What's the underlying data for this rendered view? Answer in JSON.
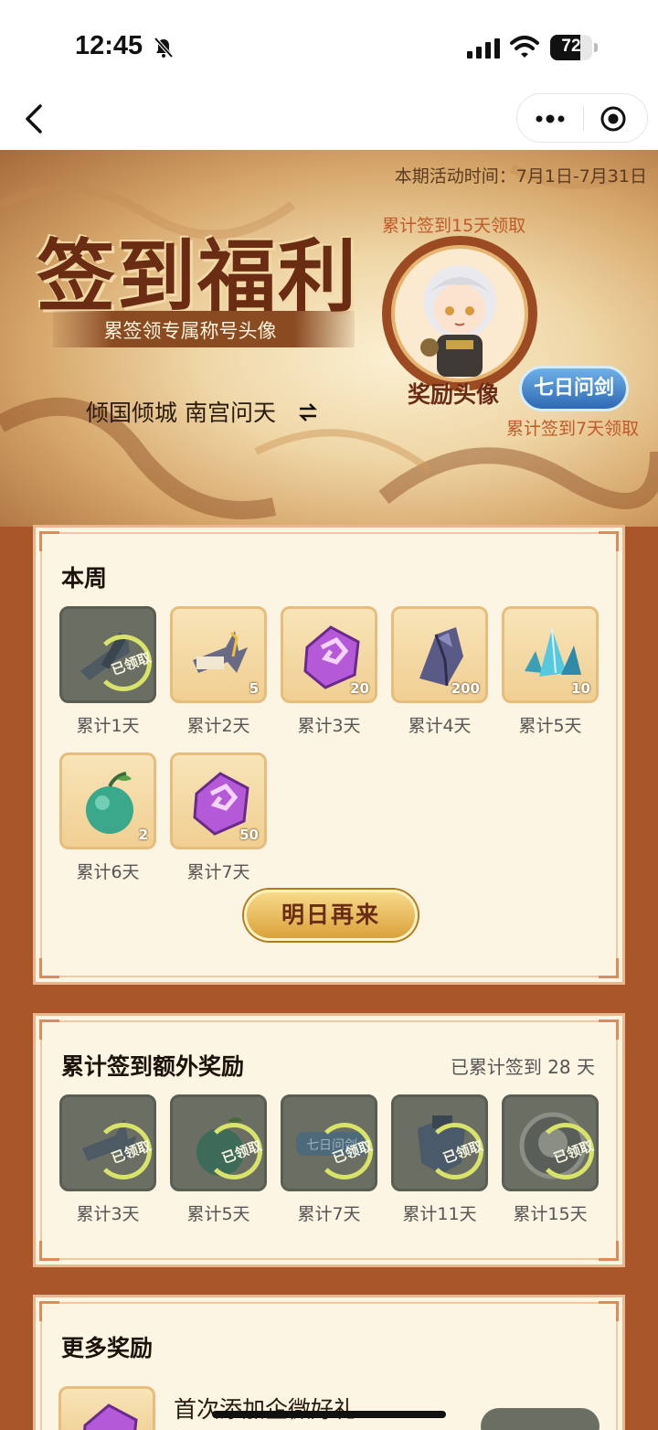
{
  "status_bar": {
    "time": "12:45",
    "battery": "72",
    "battery_level": 0.72
  },
  "banner": {
    "period": "本期活动时间：7月1日-7月31日",
    "title": "签到福利",
    "subtitle": "累签领专属称号头像",
    "player_title": "倾国倾城  南宫问天",
    "avatar_caption_top": "累计签到15天领取",
    "avatar_label": "奖励头像",
    "badge": "七日问剑",
    "avatar_caption_bottom": "累计签到7天领取"
  },
  "week": {
    "title": "本周",
    "items": [
      {
        "label": "累计1天",
        "qty": "",
        "claimed": true,
        "claimed_text": "已领取",
        "icon": "weapon-icon"
      },
      {
        "label": "累计2天",
        "qty": "5",
        "claimed": false,
        "icon": "scroll-blade-icon"
      },
      {
        "label": "累计3天",
        "qty": "20",
        "claimed": false,
        "icon": "purple-rune-icon"
      },
      {
        "label": "累计4天",
        "qty": "200",
        "claimed": false,
        "icon": "dark-crystal-icon"
      },
      {
        "label": "累计5天",
        "qty": "10",
        "claimed": false,
        "icon": "blue-crystal-icon"
      },
      {
        "label": "累计6天",
        "qty": "2",
        "claimed": false,
        "icon": "green-gourd-icon"
      },
      {
        "label": "累计7天",
        "qty": "50",
        "claimed": false,
        "icon": "purple-rune-icon"
      }
    ],
    "cta": "明日再来"
  },
  "extra": {
    "title": "累计签到额外奖励",
    "progress": "已累计签到 28 天",
    "claimed_text": "已领取",
    "items": [
      {
        "label": "累计3天",
        "icon": "blade-icon"
      },
      {
        "label": "累计5天",
        "icon": "gourd-icon"
      },
      {
        "label": "累计7天",
        "icon": "title-plaque-icon",
        "plaque": "七日问剑"
      },
      {
        "label": "累计11天",
        "icon": "armor-icon"
      },
      {
        "label": "累计15天",
        "icon": "avatar-frame-icon"
      }
    ]
  },
  "more": {
    "title": "更多奖励",
    "first_item": "首次添加企微好礼"
  }
}
